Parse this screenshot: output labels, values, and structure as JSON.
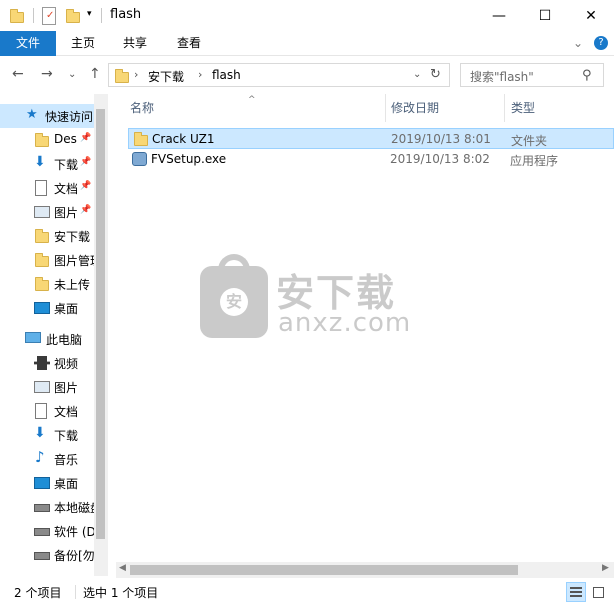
{
  "titlebar": {
    "title": "flash",
    "minimize": "—",
    "maximize": "☐",
    "close": "✕"
  },
  "ribbon": {
    "tabs": [
      "文件",
      "主页",
      "共享",
      "查看"
    ],
    "collapse": "⌄",
    "help": "?"
  },
  "address": {
    "crumbs": [
      "安下载",
      "flash"
    ],
    "search_placeholder": "搜索\"flash\""
  },
  "sidebar": {
    "quick_access": "快速访问",
    "quick_items": [
      "Des",
      "下载",
      "文档",
      "图片",
      "安下载",
      "图片管理",
      "未上传",
      "桌面"
    ],
    "this_pc": "此电脑",
    "pc_items": [
      "视频",
      "图片",
      "文档",
      "下载",
      "音乐",
      "桌面",
      "本地磁盘",
      "软件 (D",
      "备份[勿"
    ]
  },
  "columns": {
    "name": "名称",
    "date": "修改日期",
    "type": "类型"
  },
  "files": [
    {
      "name": "Crack UZ1",
      "date": "2019/10/13 8:01",
      "type": "文件夹",
      "icon": "folder-icon"
    },
    {
      "name": "FVSetup.exe",
      "date": "2019/10/13 8:02",
      "type": "应用程序",
      "icon": "installer-icon"
    }
  ],
  "watermark": {
    "mark": "安",
    "line1": "安下载",
    "line2": "anxz.com"
  },
  "status": {
    "count": "2 个项目",
    "selection": "选中 1 个项目"
  },
  "colors": {
    "accent": "#1979ca",
    "selection": "#cce8ff",
    "selection_border": "#99d1ff",
    "folder": "#f8d775"
  }
}
